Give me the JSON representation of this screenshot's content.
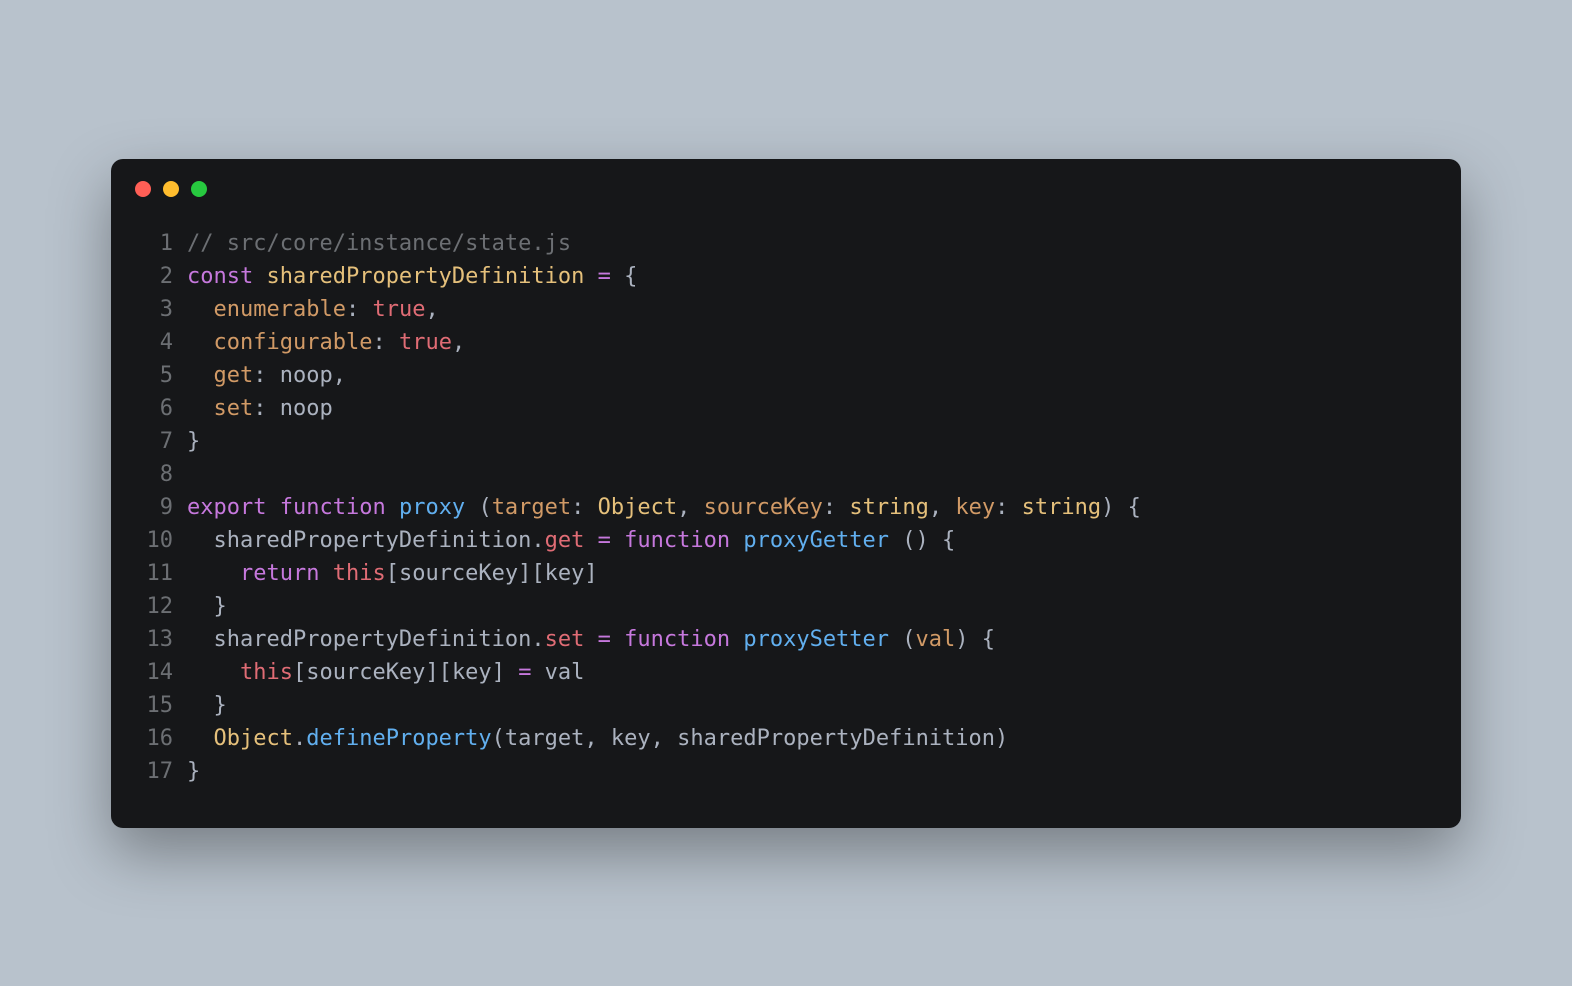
{
  "window": {
    "trafficLights": [
      "red",
      "yellow",
      "green"
    ]
  },
  "code": {
    "lines": [
      {
        "n": "1",
        "tokens": [
          {
            "cls": "c-comment",
            "t": "// src/core/instance/state.js"
          }
        ]
      },
      {
        "n": "2",
        "tokens": [
          {
            "cls": "c-keyword",
            "t": "const"
          },
          {
            "cls": "c-plain",
            "t": " "
          },
          {
            "cls": "c-const",
            "t": "sharedPropertyDefinition"
          },
          {
            "cls": "c-plain",
            "t": " "
          },
          {
            "cls": "c-keyword",
            "t": "="
          },
          {
            "cls": "c-plain",
            "t": " "
          },
          {
            "cls": "c-punc",
            "t": "{"
          }
        ]
      },
      {
        "n": "3",
        "tokens": [
          {
            "cls": "c-plain",
            "t": "  "
          },
          {
            "cls": "c-prop",
            "t": "enumerable"
          },
          {
            "cls": "c-punc",
            "t": ": "
          },
          {
            "cls": "c-value",
            "t": "true"
          },
          {
            "cls": "c-punc",
            "t": ","
          }
        ]
      },
      {
        "n": "4",
        "tokens": [
          {
            "cls": "c-plain",
            "t": "  "
          },
          {
            "cls": "c-prop",
            "t": "configurable"
          },
          {
            "cls": "c-punc",
            "t": ": "
          },
          {
            "cls": "c-value",
            "t": "true"
          },
          {
            "cls": "c-punc",
            "t": ","
          }
        ]
      },
      {
        "n": "5",
        "tokens": [
          {
            "cls": "c-plain",
            "t": "  "
          },
          {
            "cls": "c-prop",
            "t": "get"
          },
          {
            "cls": "c-punc",
            "t": ": "
          },
          {
            "cls": "c-plain",
            "t": "noop"
          },
          {
            "cls": "c-punc",
            "t": ","
          }
        ]
      },
      {
        "n": "6",
        "tokens": [
          {
            "cls": "c-plain",
            "t": "  "
          },
          {
            "cls": "c-prop",
            "t": "set"
          },
          {
            "cls": "c-punc",
            "t": ": "
          },
          {
            "cls": "c-plain",
            "t": "noop"
          }
        ]
      },
      {
        "n": "7",
        "tokens": [
          {
            "cls": "c-punc",
            "t": "}"
          }
        ]
      },
      {
        "n": "8",
        "tokens": [
          {
            "cls": "c-plain",
            "t": ""
          }
        ]
      },
      {
        "n": "9",
        "tokens": [
          {
            "cls": "c-keyword",
            "t": "export"
          },
          {
            "cls": "c-plain",
            "t": " "
          },
          {
            "cls": "c-keyword",
            "t": "function"
          },
          {
            "cls": "c-plain",
            "t": " "
          },
          {
            "cls": "c-def",
            "t": "proxy"
          },
          {
            "cls": "c-plain",
            "t": " "
          },
          {
            "cls": "c-punc",
            "t": "("
          },
          {
            "cls": "c-param",
            "t": "target"
          },
          {
            "cls": "c-punc",
            "t": ": "
          },
          {
            "cls": "c-type",
            "t": "Object"
          },
          {
            "cls": "c-punc",
            "t": ", "
          },
          {
            "cls": "c-param",
            "t": "sourceKey"
          },
          {
            "cls": "c-punc",
            "t": ": "
          },
          {
            "cls": "c-type",
            "t": "string"
          },
          {
            "cls": "c-punc",
            "t": ", "
          },
          {
            "cls": "c-param",
            "t": "key"
          },
          {
            "cls": "c-punc",
            "t": ": "
          },
          {
            "cls": "c-type",
            "t": "string"
          },
          {
            "cls": "c-punc",
            "t": ") {"
          }
        ]
      },
      {
        "n": "10",
        "tokens": [
          {
            "cls": "c-plain",
            "t": "  sharedPropertyDefinition"
          },
          {
            "cls": "c-punc",
            "t": "."
          },
          {
            "cls": "c-value",
            "t": "get"
          },
          {
            "cls": "c-plain",
            "t": " "
          },
          {
            "cls": "c-keyword",
            "t": "="
          },
          {
            "cls": "c-plain",
            "t": " "
          },
          {
            "cls": "c-keyword",
            "t": "function"
          },
          {
            "cls": "c-plain",
            "t": " "
          },
          {
            "cls": "c-def",
            "t": "proxyGetter"
          },
          {
            "cls": "c-plain",
            "t": " "
          },
          {
            "cls": "c-punc",
            "t": "() {"
          }
        ]
      },
      {
        "n": "11",
        "tokens": [
          {
            "cls": "c-plain",
            "t": "    "
          },
          {
            "cls": "c-keyword",
            "t": "return"
          },
          {
            "cls": "c-plain",
            "t": " "
          },
          {
            "cls": "c-value",
            "t": "this"
          },
          {
            "cls": "c-punc",
            "t": "["
          },
          {
            "cls": "c-plain",
            "t": "sourceKey"
          },
          {
            "cls": "c-punc",
            "t": "]["
          },
          {
            "cls": "c-plain",
            "t": "key"
          },
          {
            "cls": "c-punc",
            "t": "]"
          }
        ]
      },
      {
        "n": "12",
        "tokens": [
          {
            "cls": "c-plain",
            "t": "  "
          },
          {
            "cls": "c-punc",
            "t": "}"
          }
        ]
      },
      {
        "n": "13",
        "tokens": [
          {
            "cls": "c-plain",
            "t": "  sharedPropertyDefinition"
          },
          {
            "cls": "c-punc",
            "t": "."
          },
          {
            "cls": "c-value",
            "t": "set"
          },
          {
            "cls": "c-plain",
            "t": " "
          },
          {
            "cls": "c-keyword",
            "t": "="
          },
          {
            "cls": "c-plain",
            "t": " "
          },
          {
            "cls": "c-keyword",
            "t": "function"
          },
          {
            "cls": "c-plain",
            "t": " "
          },
          {
            "cls": "c-def",
            "t": "proxySetter"
          },
          {
            "cls": "c-plain",
            "t": " "
          },
          {
            "cls": "c-punc",
            "t": "("
          },
          {
            "cls": "c-param",
            "t": "val"
          },
          {
            "cls": "c-punc",
            "t": ") {"
          }
        ]
      },
      {
        "n": "14",
        "tokens": [
          {
            "cls": "c-plain",
            "t": "    "
          },
          {
            "cls": "c-value",
            "t": "this"
          },
          {
            "cls": "c-punc",
            "t": "["
          },
          {
            "cls": "c-plain",
            "t": "sourceKey"
          },
          {
            "cls": "c-punc",
            "t": "]["
          },
          {
            "cls": "c-plain",
            "t": "key"
          },
          {
            "cls": "c-punc",
            "t": "] "
          },
          {
            "cls": "c-keyword",
            "t": "="
          },
          {
            "cls": "c-plain",
            "t": " val"
          }
        ]
      },
      {
        "n": "15",
        "tokens": [
          {
            "cls": "c-plain",
            "t": "  "
          },
          {
            "cls": "c-punc",
            "t": "}"
          }
        ]
      },
      {
        "n": "16",
        "tokens": [
          {
            "cls": "c-plain",
            "t": "  "
          },
          {
            "cls": "c-type",
            "t": "Object"
          },
          {
            "cls": "c-punc",
            "t": "."
          },
          {
            "cls": "c-def",
            "t": "defineProperty"
          },
          {
            "cls": "c-punc",
            "t": "("
          },
          {
            "cls": "c-plain",
            "t": "target"
          },
          {
            "cls": "c-punc",
            "t": ", "
          },
          {
            "cls": "c-plain",
            "t": "key"
          },
          {
            "cls": "c-punc",
            "t": ", "
          },
          {
            "cls": "c-plain",
            "t": "sharedPropertyDefinition"
          },
          {
            "cls": "c-punc",
            "t": ")"
          }
        ]
      },
      {
        "n": "17",
        "tokens": [
          {
            "cls": "c-punc",
            "t": "}"
          }
        ]
      }
    ]
  }
}
